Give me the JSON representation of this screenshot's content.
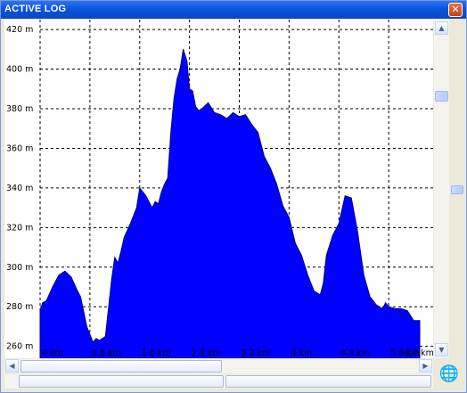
{
  "window": {
    "title": "ACTIVE LOG",
    "close_glyph": "✕"
  },
  "icons": {
    "scroll_up": "up-arrow-icon",
    "scroll_down": "down-arrow-icon",
    "scroll_left": "left-arrow-icon",
    "scroll_right": "right-arrow-icon",
    "profile": "globe-icon"
  },
  "colors": {
    "fill": "#0000ff",
    "outline": "#000080",
    "grid": "#000000",
    "title_bar": "#0a55dd"
  },
  "chart_data": {
    "type": "area",
    "title": "",
    "xlabel": "",
    "ylabel": "",
    "x_unit": "km",
    "y_unit": "m",
    "xlim": [
      0,
      6.4
    ],
    "ylim": [
      254,
      425
    ],
    "grid": true,
    "y_ticks": [
      260,
      280,
      300,
      320,
      340,
      360,
      380,
      400,
      420
    ],
    "y_tick_labels": [
      "260 m",
      "280 m",
      "300 m",
      "320 m",
      "340 m",
      "360 m",
      "380 m",
      "400 m",
      "420 m"
    ],
    "x_ticks": [
      0,
      0.8,
      1.6,
      2.4,
      3.2,
      4,
      4.8,
      5.6
    ],
    "x_tick_labels": [
      "0 km",
      "0.8 km",
      "1.6 km",
      "2.4 km",
      "3.2 km",
      "4 km",
      "4.8 km",
      "5.6 km"
    ],
    "x_end_label": "6.4 km",
    "series": [
      {
        "x": [
          0,
          0.04,
          0.1,
          0.2,
          0.3,
          0.4,
          0.5,
          0.6,
          0.65,
          0.75,
          0.85,
          0.9,
          0.95,
          1.05,
          1.15,
          1.2,
          1.25,
          1.3,
          1.35,
          1.45,
          1.55,
          1.6,
          1.7,
          1.8,
          1.85,
          1.9,
          1.95,
          2.0,
          2.05,
          2.1,
          2.15,
          2.2,
          2.25,
          2.3,
          2.33,
          2.36,
          2.4,
          2.45,
          2.5,
          2.55,
          2.6,
          2.7,
          2.8,
          2.9,
          3.0,
          3.1,
          3.2,
          3.3,
          3.4,
          3.5,
          3.6,
          3.7,
          3.8,
          3.9,
          4.0,
          4.1,
          4.2,
          4.3,
          4.4,
          4.5,
          4.55,
          4.6,
          4.7,
          4.8,
          4.9,
          5.0,
          5.1,
          5.2,
          5.3,
          5.4,
          5.5,
          5.55,
          5.6,
          5.7,
          5.8,
          5.9,
          6.0,
          6.1
        ],
        "y": [
          278,
          282,
          283,
          290,
          296,
          298,
          295,
          288,
          285,
          270,
          262,
          264,
          263,
          265,
          294,
          305,
          302,
          308,
          315,
          322,
          330,
          340,
          336,
          330,
          333,
          332,
          338,
          342,
          345,
          368,
          385,
          395,
          400,
          410,
          407,
          404,
          390,
          389,
          381,
          379,
          380,
          383,
          378,
          377,
          375,
          378,
          376,
          377,
          372,
          368,
          356,
          350,
          342,
          331,
          325,
          312,
          306,
          296,
          288,
          286,
          292,
          306,
          316,
          322,
          336,
          335,
          318,
          296,
          285,
          281,
          279,
          282,
          280,
          279,
          279,
          278,
          273,
          273
        ]
      }
    ]
  }
}
